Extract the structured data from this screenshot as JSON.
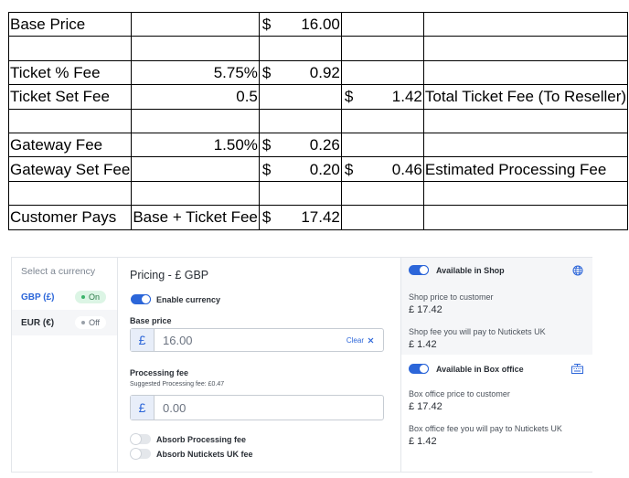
{
  "sheet": {
    "rows": [
      {
        "a": "Base Price",
        "b": "",
        "c": "16.00",
        "d": "",
        "e": ""
      },
      {
        "a": "",
        "b": "",
        "c": "",
        "d": "",
        "e": ""
      },
      {
        "a": "Ticket % Fee",
        "b": "5.75%",
        "c": "0.92",
        "d": "",
        "e": ""
      },
      {
        "a": "Ticket Set Fee",
        "b": "0.5",
        "c": "",
        "d": "1.42",
        "e": "Total Ticket Fee (To Reseller)"
      },
      {
        "a": "",
        "b": "",
        "c": "",
        "d": "",
        "e": ""
      },
      {
        "a": "Gateway Fee",
        "b": "1.50%",
        "c": "0.26",
        "d": "",
        "e": ""
      },
      {
        "a": "Gateway Set Fee",
        "b": "",
        "c": "0.20",
        "d": "0.46",
        "e": "Estimated Processing Fee"
      },
      {
        "a": "",
        "b": "",
        "c": "",
        "d": "",
        "e": ""
      },
      {
        "a": "Customer Pays",
        "b": "Base + Ticket Fee",
        "c": "17.42",
        "d": "",
        "e": ""
      }
    ],
    "currency_symbol": "$"
  },
  "currency_list": {
    "header": "Select a currency",
    "items": [
      {
        "name": "GBP (£)",
        "status": "On"
      },
      {
        "name": "EUR (€)",
        "status": "Off"
      }
    ]
  },
  "pricing": {
    "title": "Pricing - £ GBP",
    "enable_label": "Enable currency",
    "base_label": "Base price",
    "currency_prefix": "£",
    "base_value": "16.00",
    "clear_label": "Clear",
    "processing_label": "Processing fee",
    "processing_suggest": "Suggested Processing fee: £0.47",
    "processing_value": "0.00",
    "absorb_processing": "Absorb Processing fee",
    "absorb_nutickets": "Absorb Nutickets UK fee"
  },
  "availability": {
    "shop": {
      "title": "Available in Shop",
      "price_label": "Shop price to customer",
      "price_value": "£ 17.42",
      "fee_label": "Shop fee you will pay to Nutickets UK",
      "fee_value": "£ 1.42"
    },
    "box": {
      "title": "Available in Box office",
      "price_label": "Box office price to customer",
      "price_value": "£ 17.42",
      "fee_label": "Box office fee you will pay to Nutickets UK",
      "fee_value": "£ 1.42"
    }
  },
  "colors": {
    "accent": "#2c66d9",
    "on_badge": "#dcf5e5"
  }
}
